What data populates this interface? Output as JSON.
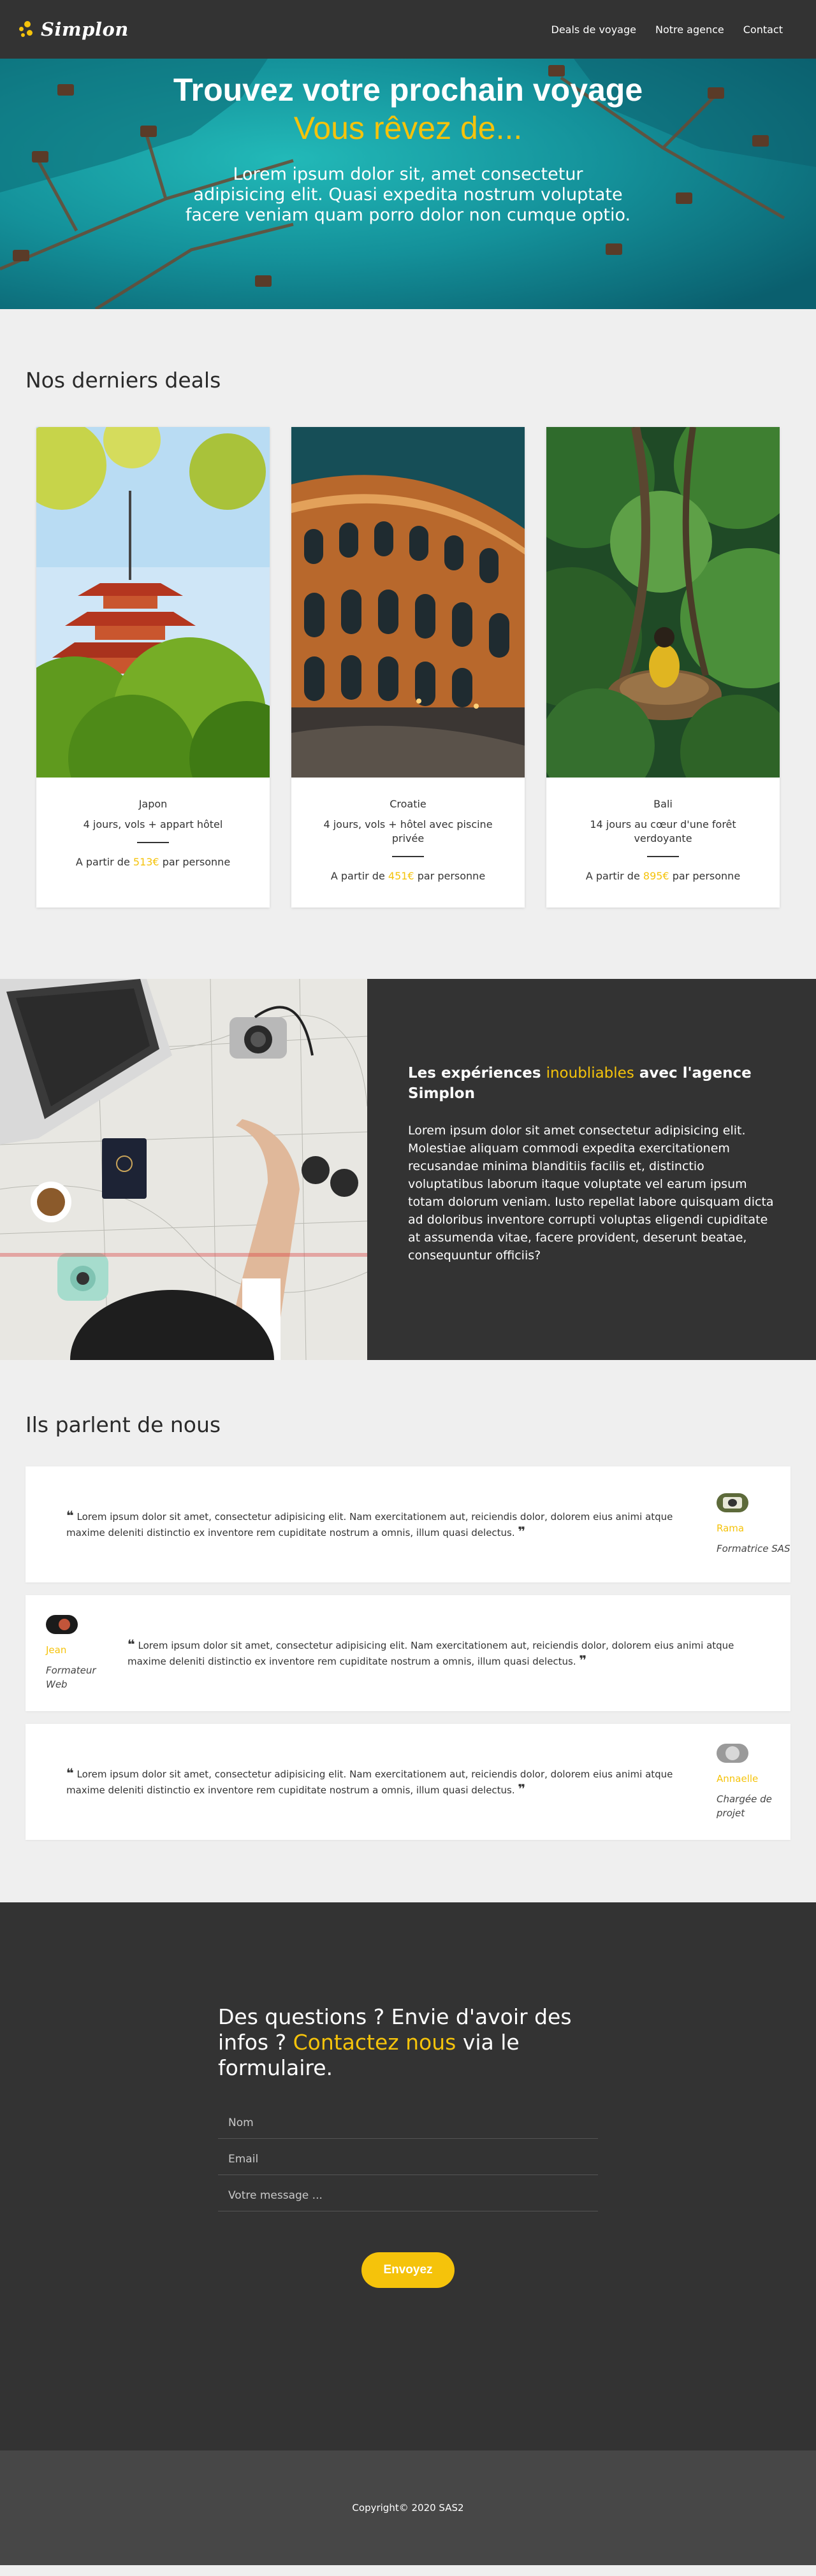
{
  "nav": {
    "brand": "Simplon",
    "links": [
      "Deals de voyage",
      "Notre agence",
      "Contact"
    ]
  },
  "hero": {
    "title": "Trouvez votre prochain voyage",
    "subtitle": "Vous rêvez de...",
    "text": "Lorem ipsum dolor sit, amet consectetur adipisicing elit. Quasi expedita nostrum voluptate facere veniam quam porro dolor non cumque optio."
  },
  "deals": {
    "title": "Nos derniers deals",
    "price_prefix": "A partir de",
    "price_suffix": "par personne",
    "items": [
      {
        "city": "Japon",
        "desc": "4 jours, vols + appart hôtel",
        "price": "513€"
      },
      {
        "city": "Croatie",
        "desc": "4 jours, vols + hôtel avec piscine privée",
        "price": "451€"
      },
      {
        "city": "Bali",
        "desc": "14 jours au cœur d'une forêt verdoyante",
        "price": "895€"
      }
    ]
  },
  "agency": {
    "title_start": "Les expériences",
    "title_highlight": "inoubliables",
    "title_end": "avec l'agence Simplon",
    "text": "Lorem ipsum dolor sit amet consectetur adipisicing elit. Molestiae aliquam commodi expedita exercitationem recusandae minima blanditiis facilis et, distinctio voluptatibus laborum itaque voluptate vel earum ipsum totam dolorum veniam. Iusto repellat labore quisquam dicta ad doloribus inventore corrupti voluptas eligendi cupiditate at assumenda vitae, facere provident, deserunt beatae, consequuntur officiis?"
  },
  "testimonials": {
    "title": "Ils parlent de nous",
    "items": [
      {
        "quote": "Lorem ipsum dolor sit amet, consectetur adipisicing elit. Nam exercitationem aut, reiciendis dolor, dolorem eius animi atque maxime deleniti distinctio ex inventore rem cupiditate nostrum a omnis, illum quasi delectus.",
        "name": "Rama",
        "role": "Formatrice SAS"
      },
      {
        "quote": "Lorem ipsum dolor sit amet, consectetur adipisicing elit. Nam exercitationem aut, reiciendis dolor, dolorem eius animi atque maxime deleniti distinctio ex inventore rem cupiditate nostrum a omnis, illum quasi delectus.",
        "name": "Jean",
        "role": "Formateur Web"
      },
      {
        "quote": "Lorem ipsum dolor sit amet, consectetur adipisicing elit. Nam exercitationem aut, reiciendis dolor, dolorem eius animi atque maxime deleniti distinctio ex inventore rem cupiditate nostrum a omnis, illum quasi delectus.",
        "name": "Annaelle",
        "role": "Chargée de projet"
      }
    ]
  },
  "contact": {
    "title_start": "Des questions ? Envie d'avoir des infos ?",
    "title_highlight": "Contactez nous",
    "title_end": "via le formulaire.",
    "name_placeholder": "Nom",
    "email_placeholder": "Email",
    "message_placeholder": "Votre message ...",
    "submit_label": "Envoyez"
  },
  "footer": {
    "copyright": "Copyright© 2020 SAS2"
  },
  "colors": {
    "accent": "#f5c30b",
    "dark": "#333333",
    "footer": "#474747",
    "background": "#efefef"
  }
}
